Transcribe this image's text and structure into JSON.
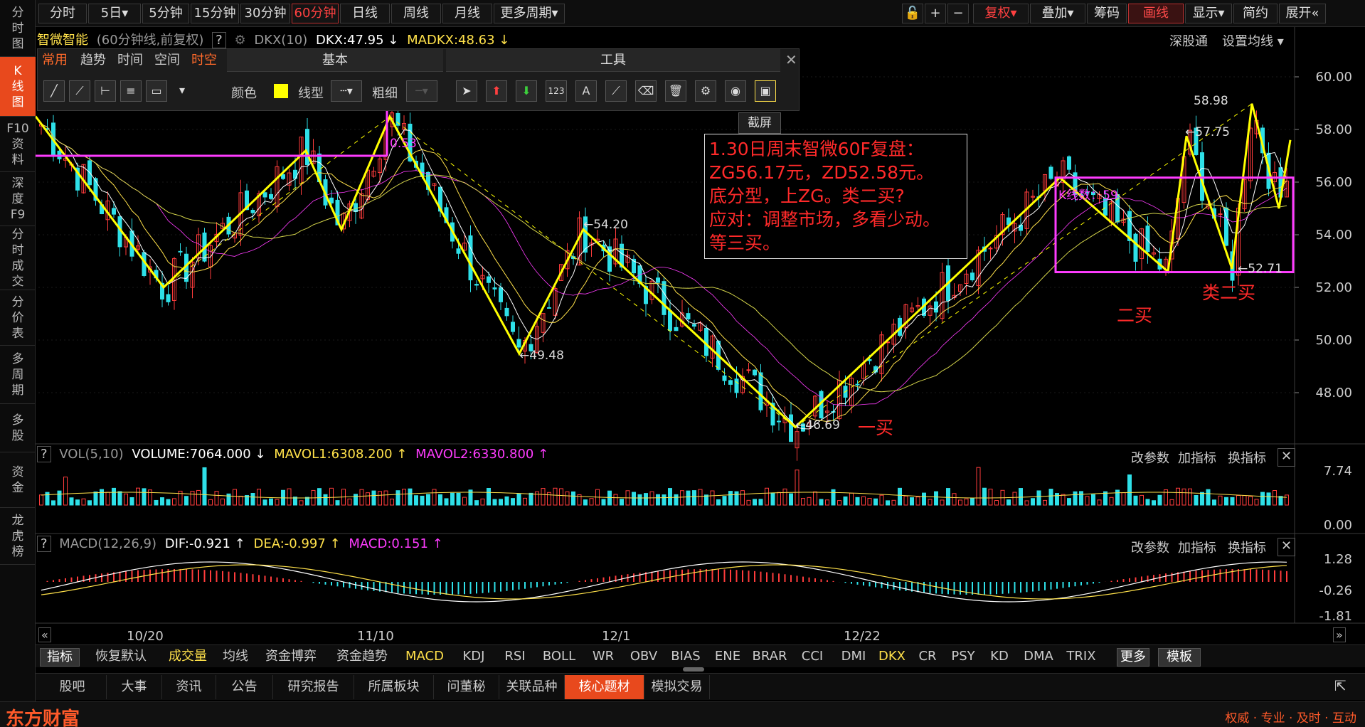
{
  "sidebar": {
    "items": [
      {
        "label": "分\n时\n图",
        "active": false
      },
      {
        "label": "K\n线\n图",
        "active": true
      },
      {
        "label": "F10\n资\n料",
        "active": false
      },
      {
        "label": "深\n度\nF9",
        "active": false
      },
      {
        "label": "分\n时\n成\n交",
        "active": false
      },
      {
        "label": "分\n价\n表",
        "active": false
      },
      {
        "label": "多\n周\n期",
        "active": false
      },
      {
        "label": "多\n股",
        "active": false
      },
      {
        "label": "资\n金",
        "active": false
      },
      {
        "label": "龙\n虎\n榜",
        "active": false
      }
    ]
  },
  "toolbar": {
    "periods": [
      "分时",
      "5日▾",
      "5分钟",
      "15分钟",
      "30分钟",
      "60分钟",
      "日线",
      "周线",
      "月线",
      "更多周期▾"
    ],
    "active_period": "60分钟",
    "right_buttons": [
      "复权▾",
      "叠加▾",
      "筹码",
      "画线",
      "显示▾",
      "简约",
      "展开«"
    ],
    "icons": [
      "lock-icon",
      "zoom-in-icon",
      "zoom-out-icon"
    ]
  },
  "info": {
    "stock_name": "智微智能",
    "chart_mode": "(60分钟线,前复权)",
    "help": "?",
    "indicator": "DKX(10)",
    "dkx": "DKX:47.95 ↓",
    "madkx": "MADKX:48.63 ↓",
    "right_links": [
      "深股通",
      "设置均线 ▾"
    ]
  },
  "draw_panel": {
    "tabs": [
      "常用",
      "趋势",
      "时间",
      "空间",
      "时空"
    ],
    "active_tab": "时空",
    "section_basic": "基本",
    "section_tools": "工具",
    "color_label": "颜色",
    "line_type_label": "线型",
    "line_width_label": "粗细",
    "close": "✕",
    "screenshot_tip": "截屏"
  },
  "note": {
    "lines": [
      "1.30日周末智微60F复盘：",
      "ZG56.17元，ZD52.58元。",
      "底分型，上ZG。类二买?",
      "应对：调整市场，多看少动。",
      "等三买。"
    ]
  },
  "annotations": {
    "p_5849": "0.53",
    "p_4948": "49.48",
    "p_5420": "←54.20",
    "p_4669": "46.69",
    "p_5898": "58.98",
    "p_5775": "57.75",
    "p_5271": "52.71",
    "kcount": "K线数：59",
    "buy1": "一买",
    "buy2": "二买",
    "buy2_like": "类二买"
  },
  "price_axis": [
    "60.00",
    "58.00",
    "56.00",
    "54.00",
    "52.00",
    "50.00",
    "48.00"
  ],
  "volume": {
    "title": "VOL(5,10)",
    "volume": "VOLUME:7064.000 ↓",
    "mavol1": "MAVOL1:6308.200 ↑",
    "mavol2": "MAVOL2:6330.800 ↑",
    "axis": [
      "7.74",
      "0.00"
    ]
  },
  "macd": {
    "title": "MACD(12,26,9)",
    "dif": "DIF:-0.921 ↑",
    "dea": "DEA:-0.997 ↑",
    "macd": "MACD:0.151 ↑",
    "axis": [
      "1.28",
      "-0.26",
      "-1.81"
    ]
  },
  "sub_actions": [
    "改参数",
    "加指标",
    "换指标"
  ],
  "dates": [
    "10/20",
    "11/10",
    "12/1",
    "12/22"
  ],
  "indicator_tabs": [
    "指标",
    "恢复默认",
    "成交量",
    "均线",
    "资金博弈",
    "资金趋势",
    "MACD",
    "KDJ",
    "RSI",
    "BOLL",
    "WR",
    "OBV",
    "BIAS",
    "ENE",
    "BRAR",
    "CCI",
    "DMI",
    "DKX",
    "CR",
    "PSY",
    "KD",
    "DMA",
    "TRIX",
    "更多",
    "模板"
  ],
  "bottom_tabs": [
    "股吧",
    "大事",
    "资讯",
    "公告",
    "研究报告",
    "所属板块",
    "问董秘",
    "关联品种",
    "核心题材",
    "模拟交易"
  ],
  "active_bottom_tab": "核心题材",
  "footer": {
    "logo": "东方财富",
    "slogan": "权威 · 专业 · 及时 · 互动"
  },
  "chart_data": {
    "type": "candlestick",
    "title": "智微智能 60分钟线 前复权",
    "ylim": [
      46.0,
      61.0
    ],
    "zigzag_pivots": [
      58.5,
      52.0,
      57.2,
      54.2,
      58.49,
      49.48,
      54.2,
      46.69,
      56.17,
      52.6,
      57.75,
      52.71,
      58.98,
      55.0,
      57.6
    ],
    "zg": 56.17,
    "zd": 52.58,
    "labels": {
      "high": 58.98,
      "low": 46.69
    }
  }
}
